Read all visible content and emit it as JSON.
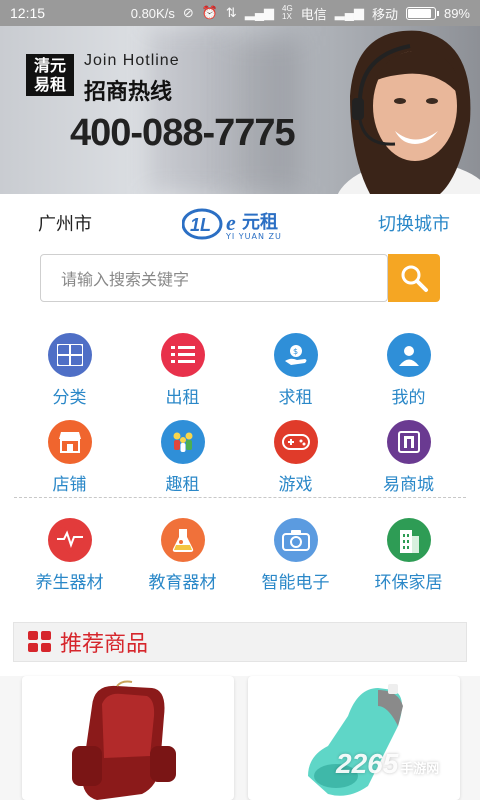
{
  "status_bar": {
    "time": "12:15",
    "speed": "0.80K/s",
    "network_labels": [
      "4G",
      "1X"
    ],
    "carrier1": "电信",
    "carrier2": "移动",
    "battery": "89%",
    "battery_level": 0.89
  },
  "banner": {
    "logo_line1": "清元",
    "logo_line2": "易租",
    "join_text": "Join Hotline",
    "hotline_cn": "招商热线",
    "phone": "400-088-7775",
    "slides": 2,
    "active_slide": 1
  },
  "header": {
    "city": "广州市",
    "brand_cn": "元租",
    "brand_pinyin": "YI YUAN ZU",
    "switch_city": "切换城市"
  },
  "search": {
    "placeholder": "请输入搜索关键字"
  },
  "grid": {
    "row1": [
      {
        "label": "分类",
        "icon": "category-grid-icon",
        "color": "#4f6fc6"
      },
      {
        "label": "出租",
        "icon": "list-icon",
        "color": "#e8314b"
      },
      {
        "label": "求租",
        "icon": "money-hand-icon",
        "color": "#2f8fd8"
      },
      {
        "label": "我的",
        "icon": "user-icon",
        "color": "#2f8fd8"
      }
    ],
    "row2": [
      {
        "label": "店铺",
        "icon": "store-icon",
        "color": "#f0652e"
      },
      {
        "label": "趣租",
        "icon": "people-icon",
        "color": "#2f8fd8"
      },
      {
        "label": "游戏",
        "icon": "gamepad-icon",
        "color": "#e03b2a"
      },
      {
        "label": "易商城",
        "icon": "mall-icon",
        "color": "#6a3a91"
      }
    ],
    "row3": [
      {
        "label": "养生器材",
        "icon": "heartbeat-icon",
        "color": "#e23b3b"
      },
      {
        "label": "教育器材",
        "icon": "flask-icon",
        "color": "#f0713a"
      },
      {
        "label": "智能电子",
        "icon": "camera-icon",
        "color": "#5b9be0"
      },
      {
        "label": "环保家居",
        "icon": "building-icon",
        "color": "#2e9c55"
      }
    ]
  },
  "recommend": {
    "title": "推荐商品"
  },
  "watermark": {
    "text": "2265",
    "suffix": "手游网"
  }
}
